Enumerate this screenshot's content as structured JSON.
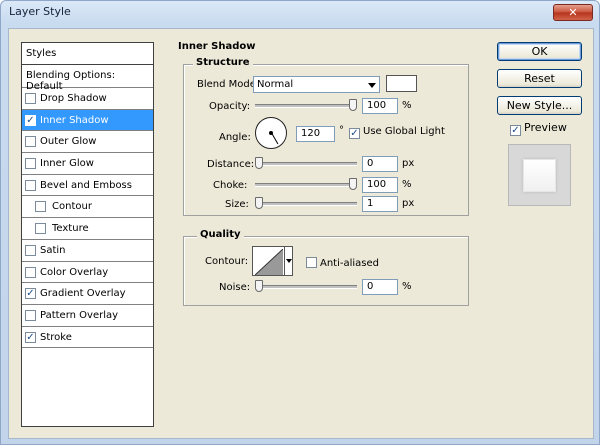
{
  "window": {
    "title": "Layer Style",
    "close_glyph": "✕"
  },
  "styles_panel": {
    "header": "Styles",
    "blending_options": "Blending Options: Default",
    "items": [
      {
        "label": "Drop Shadow",
        "checked": false,
        "selected": false,
        "sub": false
      },
      {
        "label": "Inner Shadow",
        "checked": true,
        "selected": true,
        "sub": false
      },
      {
        "label": "Outer Glow",
        "checked": false,
        "selected": false,
        "sub": false
      },
      {
        "label": "Inner Glow",
        "checked": false,
        "selected": false,
        "sub": false
      },
      {
        "label": "Bevel and Emboss",
        "checked": false,
        "selected": false,
        "sub": false
      },
      {
        "label": "Contour",
        "checked": false,
        "selected": false,
        "sub": true
      },
      {
        "label": "Texture",
        "checked": false,
        "selected": false,
        "sub": true
      },
      {
        "label": "Satin",
        "checked": false,
        "selected": false,
        "sub": false
      },
      {
        "label": "Color Overlay",
        "checked": false,
        "selected": false,
        "sub": false
      },
      {
        "label": "Gradient Overlay",
        "checked": true,
        "selected": false,
        "sub": false
      },
      {
        "label": "Pattern Overlay",
        "checked": false,
        "selected": false,
        "sub": false
      },
      {
        "label": "Stroke",
        "checked": true,
        "selected": false,
        "sub": false
      }
    ]
  },
  "inner_shadow": {
    "section_title": "Inner Shadow",
    "structure": {
      "title": "Structure",
      "blend_mode_label": "Blend Mode:",
      "blend_mode_value": "Normal",
      "shadow_color": "#ffffff",
      "opacity_label": "Opacity:",
      "opacity_value": "100",
      "opacity_level": 1.0,
      "opacity_unit": "%",
      "angle_label": "Angle:",
      "angle_value": "120",
      "angle_unit": "°",
      "use_global_light_label": "Use Global Light",
      "use_global_light_checked": true,
      "distance_label": "Distance:",
      "distance_value": "0",
      "distance_level": 0.0,
      "distance_unit": "px",
      "choke_label": "Choke:",
      "choke_value": "100",
      "choke_level": 1.0,
      "choke_unit": "%",
      "size_label": "Size:",
      "size_value": "1",
      "size_level": 0.0,
      "size_unit": "px"
    },
    "quality": {
      "title": "Quality",
      "contour_label": "Contour:",
      "anti_aliased_label": "Anti-aliased",
      "anti_aliased_checked": false,
      "noise_label": "Noise:",
      "noise_value": "0",
      "noise_level": 0.0,
      "noise_unit": "%"
    }
  },
  "buttons": {
    "ok": "OK",
    "reset": "Reset",
    "new_style": "New Style...",
    "preview_label": "Preview",
    "preview_checked": true
  }
}
